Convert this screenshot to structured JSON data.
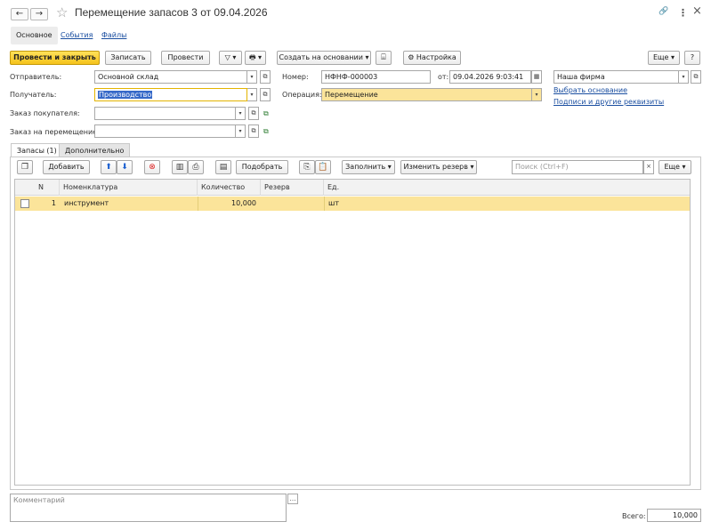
{
  "window": {
    "title": "Перемещение запасов 3 от 09.04.2026",
    "back_icon": "←",
    "forward_icon": "→",
    "star_icon": "☆",
    "link_icon": "🔗",
    "more_icon": "⋮",
    "close_icon": "×"
  },
  "top_tabs": {
    "main": "Основное",
    "events": "События",
    "files": "Файлы"
  },
  "toolbar": {
    "post_close": "Провести и закрыть",
    "save": "Записать",
    "post": "Провести",
    "create_based": "Создать на основании",
    "settings": "Настройка",
    "more": "Еще",
    "help": "?"
  },
  "form": {
    "sender_label": "Отправитель:",
    "sender_value": "Основной склад",
    "receiver_label": "Получатель:",
    "receiver_value": "Производство",
    "customer_order_label": "Заказ покупателя:",
    "customer_order_value": "",
    "transfer_order_label": "Заказ на перемещение:",
    "transfer_order_value": "",
    "number_label": "Номер:",
    "number_value": "НФНФ-000003",
    "date_label": "от:",
    "date_value": "09.04.2026  9:03:41",
    "operation_label": "Операция:",
    "operation_value": "Перемещение",
    "company_value": "Наша фирма",
    "select_base_link": "Выбрать основание",
    "signatures_link": "Подписи и другие реквизиты"
  },
  "inner_tabs": {
    "stocks": "Запасы (1)",
    "additional": "Дополнительно"
  },
  "table_toolbar": {
    "add": "Добавить",
    "pick": "Подобрать",
    "fill": "Заполнить",
    "change_reserve": "Изменить резерв",
    "search_placeholder": "Поиск (Ctrl+F)",
    "more": "Еще"
  },
  "table": {
    "columns": [
      "N",
      "Номенклатура",
      "Количество",
      "Резерв",
      "Ед."
    ],
    "rows": [
      {
        "n": "1",
        "item": "инструмент",
        "qty": "10,000",
        "reserve": "",
        "unit": "шт"
      }
    ]
  },
  "footer": {
    "comment_placeholder": "Комментарий",
    "total_label": "Всего:",
    "total_value": "10,000"
  }
}
